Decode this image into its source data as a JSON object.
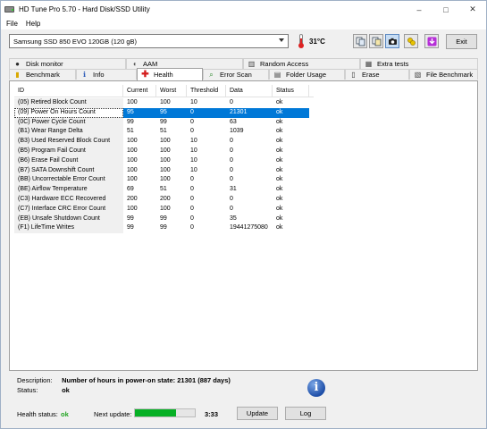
{
  "window": {
    "title": "HD Tune Pro 5.70 - Hard Disk/SSD Utility",
    "controls": [
      "–",
      "□",
      "✕"
    ]
  },
  "menu": {
    "file": "File",
    "help": "Help"
  },
  "toolbar": {
    "drive": "Samsung SSD 850 EVO 120GB (120 gB)",
    "temperature": "31°C",
    "exit_label": "Exit",
    "icons": [
      "copy-icon",
      "copy-all-icon",
      "screenshot-icon",
      "options-icon",
      "download-icon"
    ]
  },
  "tabs_top": [
    {
      "label": "Disk monitor",
      "icon": "disk-monitor-icon"
    },
    {
      "label": "AAM",
      "icon": "aam-icon"
    },
    {
      "label": "Random Access",
      "icon": "random-access-icon"
    },
    {
      "label": "Extra tests",
      "icon": "extra-tests-icon"
    }
  ],
  "tabs_bottom": [
    {
      "label": "Benchmark",
      "icon": "benchmark-icon"
    },
    {
      "label": "Info",
      "icon": "info-icon"
    },
    {
      "label": "Health",
      "icon": "health-icon",
      "active": true
    },
    {
      "label": "Error Scan",
      "icon": "error-scan-icon"
    },
    {
      "label": "Folder Usage",
      "icon": "folder-usage-icon"
    },
    {
      "label": "Erase",
      "icon": "erase-icon"
    },
    {
      "label": "File Benchmark",
      "icon": "file-benchmark-icon"
    }
  ],
  "health": {
    "columns": [
      "ID",
      "Current",
      "Worst",
      "Threshold",
      "Data",
      "Status"
    ],
    "rows": [
      [
        "(05) Retired Block Count",
        "100",
        "100",
        "10",
        "0",
        "ok"
      ],
      [
        "(09) Power On Hours Count",
        "95",
        "95",
        "0",
        "21301",
        "ok"
      ],
      [
        "(0C) Power Cycle Count",
        "99",
        "99",
        "0",
        "63",
        "ok"
      ],
      [
        "(B1) Wear Range Delta",
        "51",
        "51",
        "0",
        "1039",
        "ok"
      ],
      [
        "(B3) Used Reserved Block Count",
        "100",
        "100",
        "10",
        "0",
        "ok"
      ],
      [
        "(B5) Program Fail Count",
        "100",
        "100",
        "10",
        "0",
        "ok"
      ],
      [
        "(B6) Erase Fail Count",
        "100",
        "100",
        "10",
        "0",
        "ok"
      ],
      [
        "(B7) SATA Downshift Count",
        "100",
        "100",
        "10",
        "0",
        "ok"
      ],
      [
        "(BB) Uncorrectable Error Count",
        "100",
        "100",
        "0",
        "0",
        "ok"
      ],
      [
        "(BE) Airflow Temperature",
        "69",
        "51",
        "0",
        "31",
        "ok"
      ],
      [
        "(C3) Hardware ECC Recovered",
        "200",
        "200",
        "0",
        "0",
        "ok"
      ],
      [
        "(C7) Interface CRC Error Count",
        "100",
        "100",
        "0",
        "0",
        "ok"
      ],
      [
        "(EB) Unsafe Shutdown Count",
        "99",
        "99",
        "0",
        "35",
        "ok"
      ],
      [
        "(F1) LifeTime Writes",
        "99",
        "99",
        "0",
        "19441275080",
        "ok"
      ]
    ],
    "selected_row": 1
  },
  "details": {
    "description_label": "Description:",
    "description": "Number of hours in power-on state: 21301 (887 days)",
    "status_label": "Status:",
    "status": "ok"
  },
  "statusbar": {
    "health_label": "Health status:",
    "health_value": "ok",
    "next_update_label": "Next update:",
    "next_update_progress": 0.68,
    "next_update_time": "3:33",
    "update_label": "Update",
    "log_label": "Log"
  },
  "colors": {
    "selection": "#0078d7",
    "health_ok": "#21a321",
    "progress": "#06b025"
  }
}
